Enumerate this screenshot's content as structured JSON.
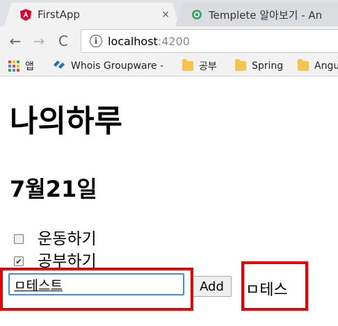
{
  "browser": {
    "tabs": [
      {
        "title": "FirstApp",
        "close": "×",
        "icon": "angular-icon"
      },
      {
        "title": "Templete 알아보기 - An",
        "icon": "site-icon"
      }
    ],
    "nav": {
      "back": "←",
      "forward": "→",
      "reload": "C"
    },
    "address": {
      "host": "localhost",
      "port": ":4200"
    },
    "bookmarks": [
      {
        "label": "앱",
        "icon": "apps-icon"
      },
      {
        "label": "Whois Groupware -",
        "icon": "whois-icon"
      },
      {
        "label": "공부",
        "icon": "folder-icon"
      },
      {
        "label": "Spring",
        "icon": "folder-icon"
      },
      {
        "label": "Angu",
        "icon": "folder-icon"
      }
    ]
  },
  "page": {
    "title": "나의하루",
    "date": "7월21일",
    "todos": [
      {
        "label": "운동하기",
        "checked": false
      },
      {
        "label": "공부하기",
        "checked": true
      }
    ],
    "input": {
      "value": "ㅁ테스트"
    },
    "add_label": "Add",
    "output": "ㅁ테스"
  },
  "colors": {
    "highlight": "#e80000",
    "input_focus": "#3e8fe6",
    "angular": "#dd0031"
  }
}
